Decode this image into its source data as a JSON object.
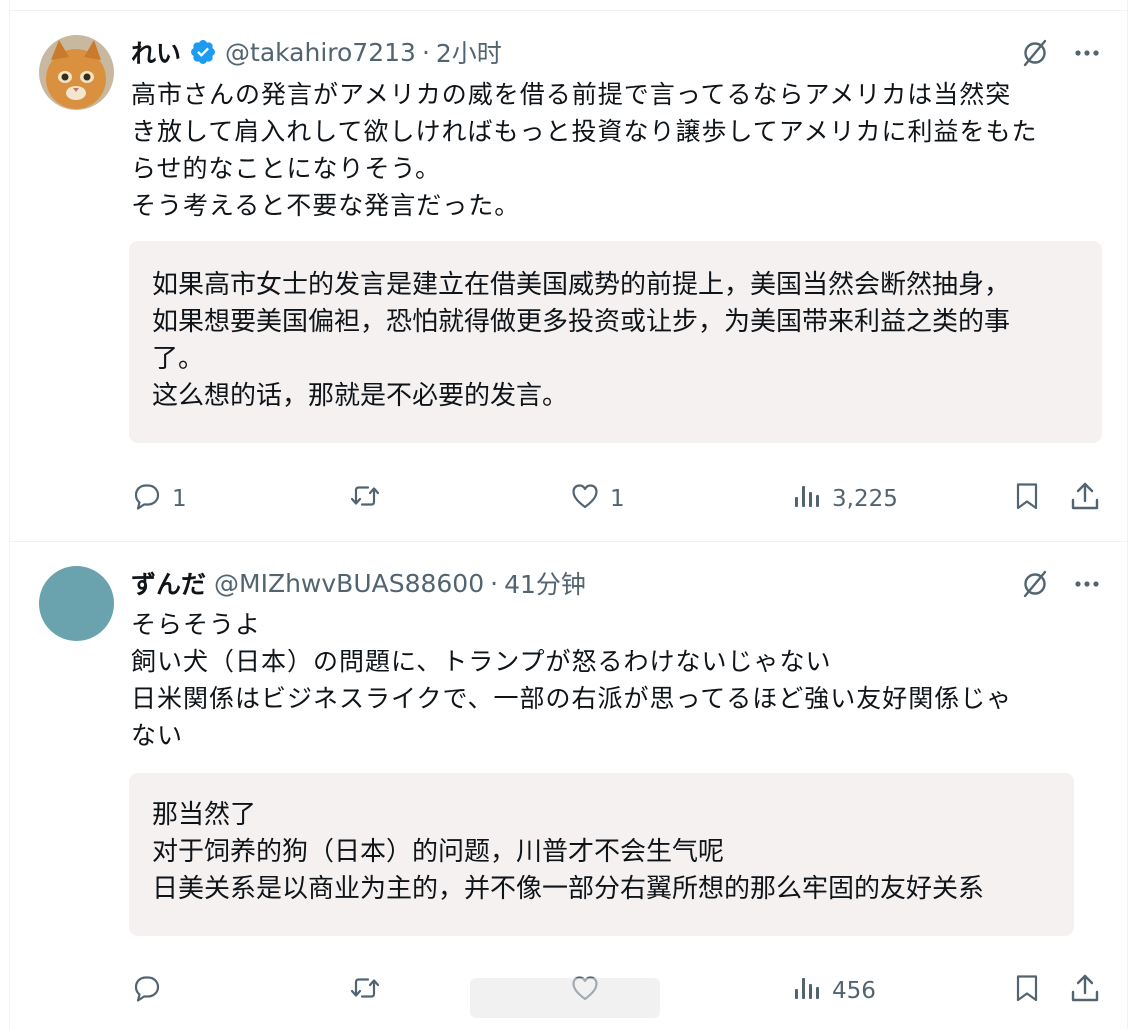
{
  "posts": [
    {
      "display_name": "れい",
      "verified": true,
      "handle": "@takahiro7213",
      "separator": "·",
      "time": "2小时",
      "text": "高市さんの発言がアメリカの威を借る前提で言ってるならアメリカは当然突\nき放して肩入れして欲しければもっと投資なり譲歩してアメリカに利益をもた\nらせ的なことになりそう。\nそう考えると不要な発言だった。",
      "translation": "如果高市女士的发言是建立在借美国威势的前提上，美国当然会断然抽身，\n如果想要美国偏袒，恐怕就得做更多投资或让步，为美国带来利益之类的事\n了。\n这么想的话，那就是不必要的发言。",
      "actions": {
        "replies": "1",
        "reposts": "",
        "likes": "1",
        "views": "3,225"
      }
    },
    {
      "display_name": "ずんだ",
      "verified": false,
      "handle": "@MIZhwvBUAS88600",
      "separator": "·",
      "time": "41分钟",
      "text": "そらそうよ\n飼い犬（日本）の問題に、トランプが怒るわけないじゃない\n日米関係はビジネスライクで、一部の右派が思ってるほど強い友好関係じゃ\nない",
      "translation": "那当然了\n对于饲养的狗（日本）的问题，川普才不会生气呢\n日美关系是以商业为主的，并不像一部分右翼所想的那么牢固的友好关系",
      "actions": {
        "replies": "",
        "reposts": "",
        "likes": "",
        "views": "456"
      }
    }
  ],
  "icons": {
    "verified": "verified-badge-icon",
    "grok": "grok-icon",
    "more": "more-icon",
    "reply": "reply-icon",
    "repost": "repost-icon",
    "like": "like-icon",
    "views": "views-icon",
    "bookmark": "bookmark-icon",
    "share": "share-icon"
  },
  "colors": {
    "text": "#0f1419",
    "secondary": "#536471",
    "verified": "#1d9bf0",
    "translation_bg": "#f4f1f0",
    "avatar_2": "#6aa3ad"
  }
}
